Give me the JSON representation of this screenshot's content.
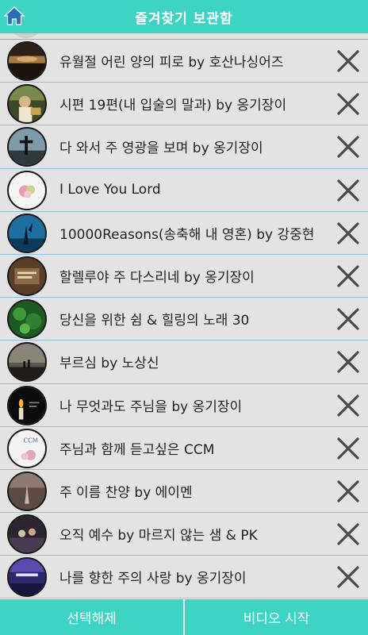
{
  "header": {
    "title": "즐겨찾기 보관함",
    "home_icon": "home-icon"
  },
  "colors": {
    "accent": "#3ed4c4",
    "row_bg": "#e3e3e3",
    "divider": "#8cbfe0",
    "delete_icon": "#4a4a4a"
  },
  "items": [
    {
      "title": "유월절 어린 양의 피로 by 호산나싱어즈",
      "thumb": "sunset-landscape"
    },
    {
      "title": "시편 19편(내 입술의 말과) by 옹기장이",
      "thumb": "woman-reading"
    },
    {
      "title": "다 와서 주 영광을 보며 by 옹기장이",
      "thumb": "cross-sky"
    },
    {
      "title": "I Love You Lord",
      "thumb": "flowers-white"
    },
    {
      "title": "10000Reasons(송축해 내 영혼) by 강중현",
      "thumb": "raised-hands-blue"
    },
    {
      "title": "할렐루야 주 다스리네 by 옹기장이",
      "thumb": "brown-text-card"
    },
    {
      "title": "당신을 위한 쉼 & 힐링의 노래 30",
      "thumb": "green-leaves"
    },
    {
      "title": "부르심 by 노상신",
      "thumb": "dusk-silhouette"
    },
    {
      "title": "나 무엇과도 주님을 by 옹기장이",
      "thumb": "candle-dark"
    },
    {
      "title": "주님과 함께 듣고싶은 CCM",
      "thumb": "ccm-flowers"
    },
    {
      "title": "주 이름 찬양 by 에이멘",
      "thumb": "praying-hands"
    },
    {
      "title": "오직 예수 by 마르지 않는 샘 & PK",
      "thumb": "worship-stage"
    },
    {
      "title": "나를 향한 주의 사랑 by 옹기장이",
      "thumb": "purple-stage"
    }
  ],
  "ccm_thumb_label": "CCM",
  "footer": {
    "deselect_label": "선택해제",
    "start_video_label": "비디오 시작"
  }
}
